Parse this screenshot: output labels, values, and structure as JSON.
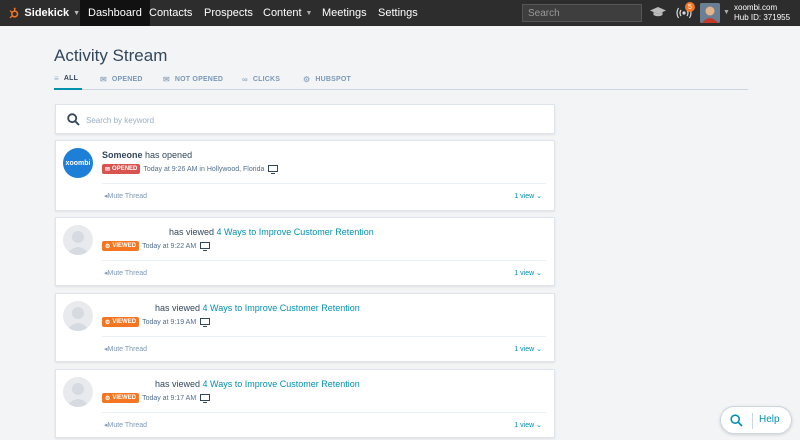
{
  "topnav": {
    "brand": "Sidekick",
    "items": [
      {
        "label": "Dashboard",
        "active": true
      },
      {
        "label": "Contacts"
      },
      {
        "label": "Prospects"
      },
      {
        "label": "Content",
        "has_caret": true
      },
      {
        "label": "Meetings"
      },
      {
        "label": "Settings"
      }
    ],
    "search_placeholder": "Search",
    "notification_count": "5",
    "account_name": "xoombi.com",
    "hub_id": "Hub ID: 371955"
  },
  "page": {
    "title": "Activity Stream",
    "tabs": [
      {
        "label": "ALL",
        "icon": "list-icon",
        "active": true
      },
      {
        "label": "OPENED",
        "icon": "envelope-open-icon"
      },
      {
        "label": "NOT OPENED",
        "icon": "envelope-icon"
      },
      {
        "label": "CLICKS",
        "icon": "link-icon"
      },
      {
        "label": "HUBSPOT",
        "icon": "sprocket-icon"
      }
    ],
    "search_placeholder": "Search by keyword"
  },
  "activities": [
    {
      "avatar": "company",
      "avatar_text": "xoombi",
      "actor": "Someone",
      "verb": "has opened",
      "link": "",
      "tag": "OPENED",
      "time": "Today at 9:26 AM",
      "location": "in Hollywood, Florida",
      "mute": "Mute Thread",
      "views": "1 view"
    },
    {
      "avatar": "person",
      "actor": "",
      "verb": "has viewed",
      "link": "4 Ways to Improve Customer Retention",
      "tag": "VIEWED",
      "time": "Today at 9:22 AM",
      "location": "",
      "mute": "Mute Thread",
      "views": "1 view"
    },
    {
      "avatar": "person",
      "actor": "",
      "verb": "has viewed",
      "link": "4 Ways to Improve Customer Retention",
      "tag": "VIEWED",
      "time": "Today at 9:19 AM",
      "location": "",
      "mute": "Mute Thread",
      "views": "1 view"
    },
    {
      "avatar": "person",
      "actor": "",
      "verb": "has viewed",
      "link": "4 Ways to Improve Customer Retention",
      "tag": "VIEWED",
      "time": "Today at 9:17 AM",
      "location": "",
      "mute": "Mute Thread",
      "views": "1 view"
    }
  ],
  "help": {
    "label": "Help"
  },
  "colors": {
    "nav_bg": "#2d2d2d",
    "accent": "#0091ae",
    "opened": "#d9534f",
    "viewed": "#f47622",
    "company_avatar": "#1d7fd8"
  }
}
